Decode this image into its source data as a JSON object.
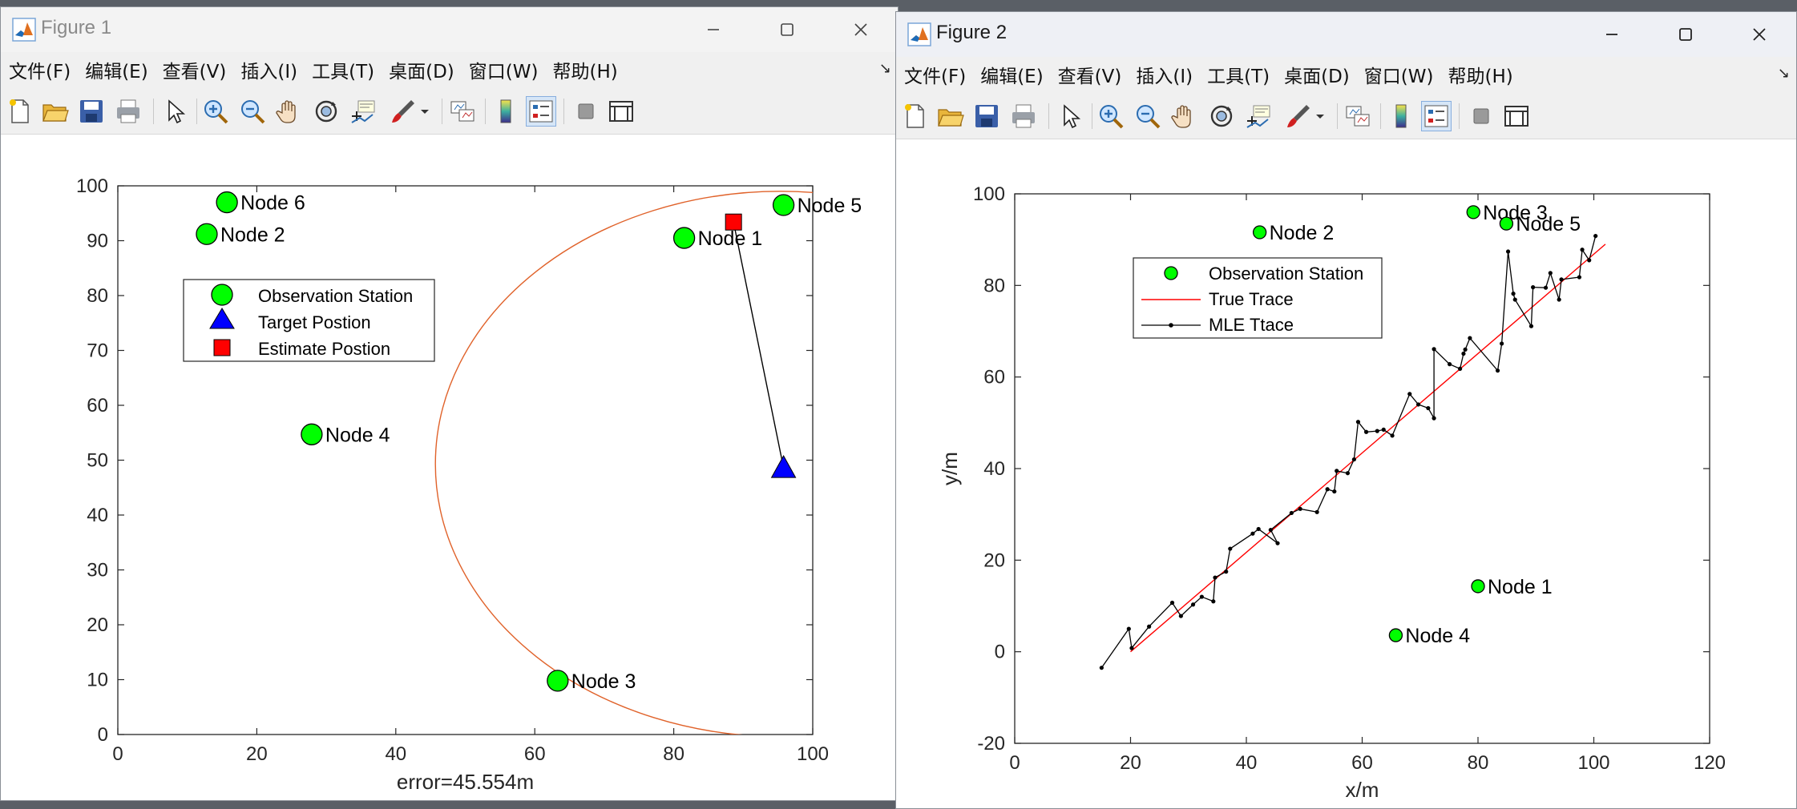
{
  "figure1": {
    "title": "Figure 1",
    "menu": [
      "文件(F)",
      "编辑(E)",
      "查看(V)",
      "插入(I)",
      "工具(T)",
      "桌面(D)",
      "窗口(W)",
      "帮助(H)"
    ],
    "chart_data": {
      "type": "scatter",
      "xlim": [
        0,
        100
      ],
      "ylim": [
        0,
        100
      ],
      "xticks": [
        "0",
        "20",
        "40",
        "60",
        "80",
        "100"
      ],
      "yticks": [
        "0",
        "10",
        "20",
        "30",
        "40",
        "50",
        "60",
        "70",
        "80",
        "90",
        "100"
      ],
      "xlabel": "error=45.554m",
      "ylabel": "",
      "grid": false,
      "legend_position": "upper-left",
      "legend": [
        "Observation Station",
        "Target Postion",
        "Estimate Postion"
      ],
      "stations": [
        {
          "label": "Node 1",
          "x": 81.5,
          "y": 90.5
        },
        {
          "label": "Node 2",
          "x": 12.8,
          "y": 91.2
        },
        {
          "label": "Node 3",
          "x": 63.3,
          "y": 9.8
        },
        {
          "label": "Node 4",
          "x": 27.9,
          "y": 54.7
        },
        {
          "label": "Node 5",
          "x": 95.8,
          "y": 96.5
        },
        {
          "label": "Node 6",
          "x": 15.7,
          "y": 97.0
        }
      ],
      "target": {
        "x": 95.8,
        "y": 48.6
      },
      "estimate": {
        "x": 88.6,
        "y": 93.4
      },
      "circle": {
        "center_x": 95.4,
        "center_y": 49.3,
        "radius": 49.7
      },
      "colors": {
        "station": "#00ff00",
        "target": "#0000ff",
        "estimate": "#ff0000",
        "circle": "#e0622a",
        "link": "#000000"
      }
    }
  },
  "figure2": {
    "title": "Figure 2",
    "menu": [
      "文件(F)",
      "编辑(E)",
      "查看(V)",
      "插入(I)",
      "工具(T)",
      "桌面(D)",
      "窗口(W)",
      "帮助(H)"
    ],
    "chart_data": {
      "type": "line",
      "xlim": [
        0,
        120
      ],
      "ylim": [
        -20,
        100
      ],
      "xticks": [
        "0",
        "20",
        "40",
        "60",
        "80",
        "100",
        "120"
      ],
      "yticks": [
        "-20",
        "0",
        "20",
        "40",
        "60",
        "80",
        "100"
      ],
      "xlabel": "x/m",
      "ylabel": "y/m",
      "grid": false,
      "legend_position": "upper-left",
      "legend": [
        "Observation Station",
        "True Trace",
        "MLE Ttace"
      ],
      "stations": [
        {
          "label": "Node 1",
          "x": 80.0,
          "y": 14.3
        },
        {
          "label": "Node 2",
          "x": 42.3,
          "y": 91.6
        },
        {
          "label": "Node 3",
          "x": 79.2,
          "y": 96.0
        },
        {
          "label": "Node 4",
          "x": 65.8,
          "y": 3.6
        },
        {
          "label": "Node 5",
          "x": 84.9,
          "y": 93.5
        }
      ],
      "true_trace": [
        [
          20,
          0
        ],
        [
          102,
          89
        ]
      ],
      "mle_trace": [
        [
          15,
          -3.5
        ],
        [
          19.7,
          5
        ],
        [
          20.2,
          0.8
        ],
        [
          23.2,
          5.5
        ],
        [
          27.2,
          10.7
        ],
        [
          28.7,
          7.8
        ],
        [
          30.8,
          10.3
        ],
        [
          32.3,
          12
        ],
        [
          34.3,
          11
        ],
        [
          34.6,
          16.2
        ],
        [
          36.5,
          17.5
        ],
        [
          37.2,
          22.5
        ],
        [
          41.1,
          25.8
        ],
        [
          42.1,
          26.8
        ],
        [
          45.4,
          23.7
        ],
        [
          44.2,
          26.6
        ],
        [
          47.8,
          30.3
        ],
        [
          49.3,
          31.2
        ],
        [
          52.2,
          30.5
        ],
        [
          54.0,
          35.5
        ],
        [
          55.2,
          35.0
        ],
        [
          55.6,
          39.5
        ],
        [
          57.5,
          39.0
        ],
        [
          58.6,
          42.0
        ],
        [
          59.3,
          50.2
        ],
        [
          60.7,
          48.0
        ],
        [
          62.6,
          48.2
        ],
        [
          63.7,
          48.5
        ],
        [
          65.2,
          47.2
        ],
        [
          68.2,
          56.3
        ],
        [
          69.7,
          54.0
        ],
        [
          71.4,
          53.2
        ],
        [
          72.4,
          51.0
        ],
        [
          72.4,
          66.1
        ],
        [
          75.1,
          62.8
        ],
        [
          76.9,
          61.8
        ],
        [
          77.5,
          65.1
        ],
        [
          77.8,
          66.0
        ],
        [
          78.6,
          68.5
        ],
        [
          83.4,
          61.4
        ],
        [
          84.1,
          67.3
        ],
        [
          85.2,
          87.4
        ],
        [
          86.1,
          78.2
        ],
        [
          86.4,
          76.9
        ],
        [
          89.2,
          71.1
        ],
        [
          89.5,
          79.6
        ],
        [
          91.7,
          79.5
        ],
        [
          92.5,
          82.7
        ],
        [
          94.0,
          76.9
        ],
        [
          94.4,
          81.3
        ],
        [
          97.5,
          81.8
        ],
        [
          98.0,
          87.8
        ],
        [
          99.2,
          85.5
        ],
        [
          100.3,
          90.8
        ]
      ],
      "colors": {
        "station": "#00ff00",
        "true": "#ff0000",
        "mle": "#000000"
      }
    }
  }
}
